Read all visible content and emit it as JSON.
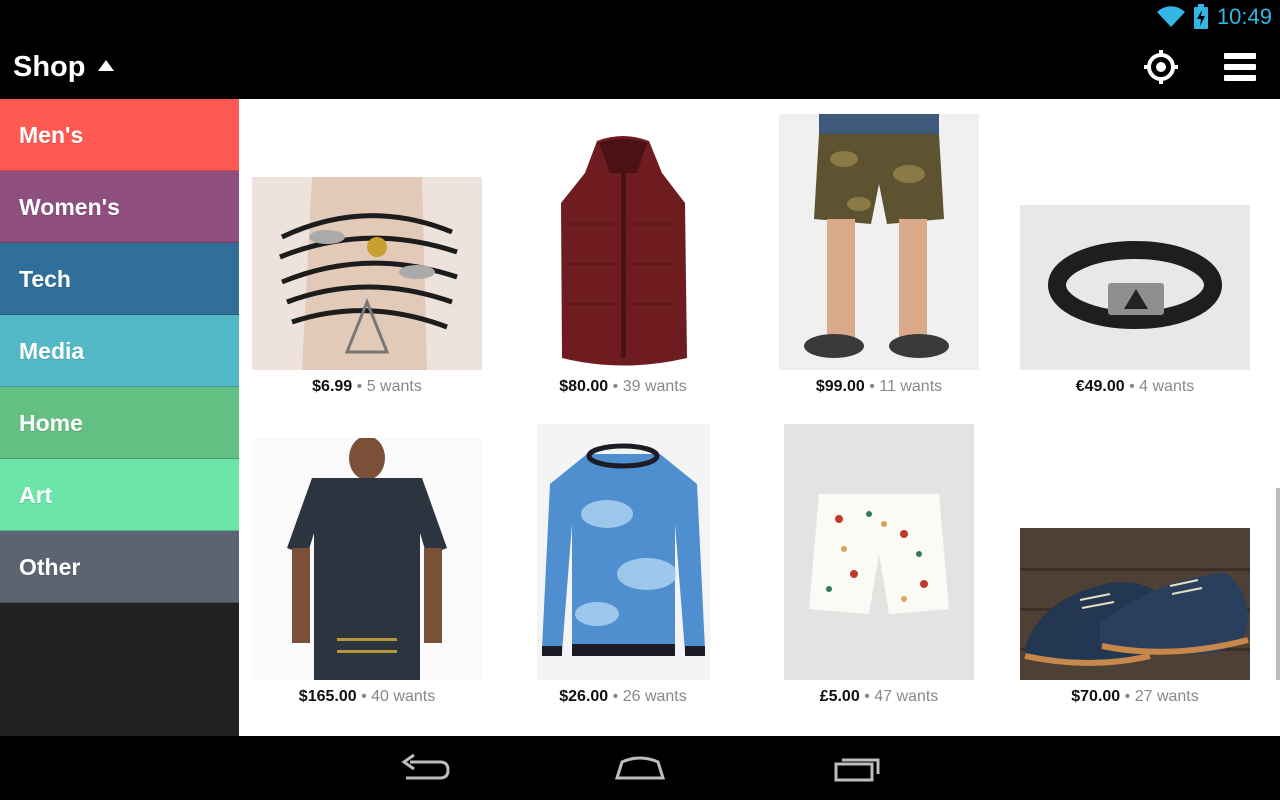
{
  "status": {
    "time": "10:49",
    "wifi_icon": "wifi-icon",
    "battery_icon": "battery-charging-icon",
    "accent": "#33b5e5"
  },
  "actionbar": {
    "title": "Shop",
    "title_icon": "caret-up-icon",
    "locate_icon": "my-location-icon",
    "menu_icon": "menu-icon"
  },
  "sidebar": {
    "items": [
      {
        "label": "Men's",
        "color": "#ff5a52"
      },
      {
        "label": "Women's",
        "color": "#8e4f7e"
      },
      {
        "label": "Tech",
        "color": "#2f6f9a"
      },
      {
        "label": "Media",
        "color": "#52b8c6"
      },
      {
        "label": "Home",
        "color": "#64bf82"
      },
      {
        "label": "Art",
        "color": "#6be6a8"
      },
      {
        "label": "Other",
        "color": "#5c6473"
      }
    ]
  },
  "products": [
    {
      "price": "$6.99",
      "wants": "5 wants",
      "image": "bracelet-image"
    },
    {
      "price": "$80.00",
      "wants": "39 wants",
      "image": "vest-image"
    },
    {
      "price": "$99.00",
      "wants": "11 wants",
      "image": "shorts-camo-image"
    },
    {
      "price": "€49.00",
      "wants": "4 wants",
      "image": "belt-image"
    },
    {
      "price": "$165.00",
      "wants": "40 wants",
      "image": "tshirt-image"
    },
    {
      "price": "$26.00",
      "wants": "26 wants",
      "image": "sweater-image"
    },
    {
      "price": "£5.00",
      "wants": "47 wants",
      "image": "shorts-print-image"
    },
    {
      "price": "$70.00",
      "wants": "27 wants",
      "image": "shoes-image"
    }
  ],
  "wants_separator": "•",
  "navbar": {
    "back_icon": "back-icon",
    "home_icon": "home-icon",
    "recents_icon": "recents-icon"
  }
}
